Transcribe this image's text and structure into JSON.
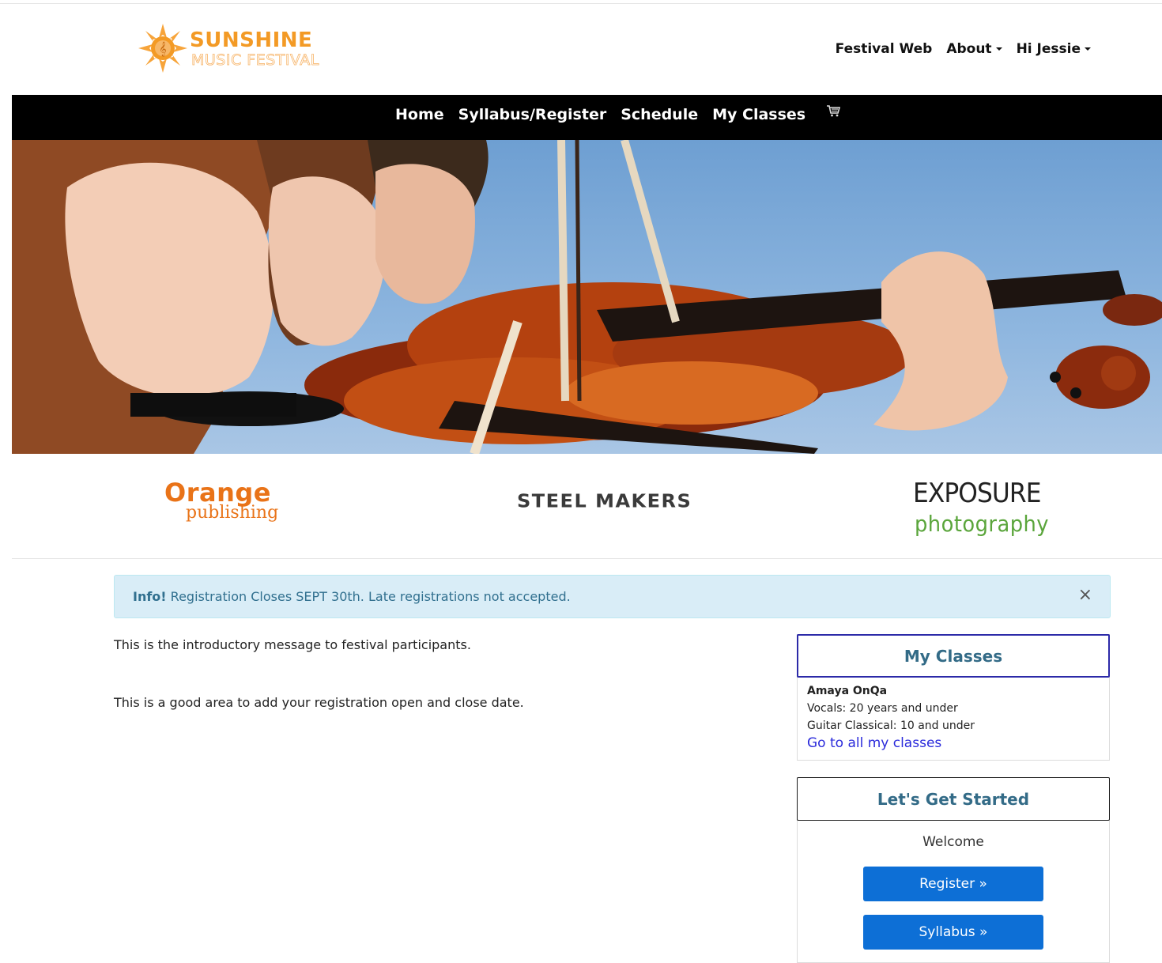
{
  "header": {
    "logo_line1": "SUNSHINE",
    "logo_line2": "MUSIC FESTIVAL",
    "links": {
      "festival_web": "Festival Web",
      "about": "About",
      "user": "Hi Jessie"
    }
  },
  "nav": {
    "home": "Home",
    "syllabus_register": "Syllabus/Register",
    "schedule": "Schedule",
    "my_classes": "My Classes",
    "cart_icon": "shopping-cart-icon"
  },
  "sponsors": {
    "orange_1": "Orange",
    "orange_2": "publishing",
    "steel": "STEEL MAKERS",
    "exposure_1": "EXPOSURE",
    "exposure_2": "photography"
  },
  "alert": {
    "label": "Info!",
    "text": " Registration Closes SEPT 30th. Late registrations not accepted.",
    "close": "×"
  },
  "content": {
    "intro": "This is the introductory message to festival participants.",
    "dates": "This is a good area to add your registration open and close date."
  },
  "my_classes": {
    "title": "My Classes",
    "student": "Amaya OnQa",
    "classes": [
      "Vocals: 20 years and under",
      "Guitar Classical: 10 and under"
    ],
    "link": "Go to all my classes"
  },
  "get_started": {
    "title": "Let's Get Started",
    "welcome": "Welcome",
    "register_btn": "Register »",
    "syllabus_btn": "Syllabus »"
  },
  "colors": {
    "brand_orange": "#f39a25",
    "nav_bg": "#000000",
    "alert_bg": "#d9edf7",
    "alert_text": "#31708f",
    "button": "#0d6fd6",
    "panel_border": "#2c2aa8",
    "panel_title": "#336b87"
  }
}
